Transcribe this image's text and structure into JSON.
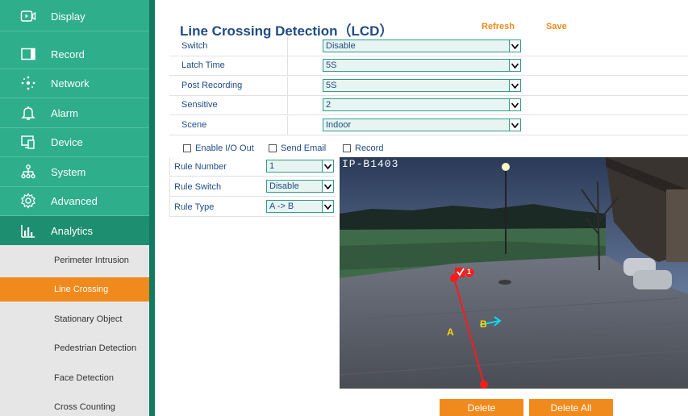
{
  "sidebar": {
    "items": [
      {
        "label": "Display",
        "icon": "display-icon"
      },
      {
        "label": "Record",
        "icon": "record-icon"
      },
      {
        "label": "Network",
        "icon": "network-icon"
      },
      {
        "label": "Alarm",
        "icon": "alarm-bell-icon"
      },
      {
        "label": "Device",
        "icon": "device-icon"
      },
      {
        "label": "System",
        "icon": "system-icon"
      },
      {
        "label": "Advanced",
        "icon": "advanced-gear-icon"
      },
      {
        "label": "Analytics",
        "icon": "analytics-chart-icon"
      }
    ],
    "active": "Analytics",
    "submenu": [
      {
        "label": "Perimeter Intrusion"
      },
      {
        "label": "Line Crossing"
      },
      {
        "label": "Stationary Object"
      },
      {
        "label": "Pedestrian Detection"
      },
      {
        "label": "Face Detection"
      },
      {
        "label": "Cross Counting"
      }
    ],
    "active_submenu": "Line Crossing"
  },
  "header": {
    "title": "Line Crossing Detection（LCD）",
    "refresh_label": "Refresh",
    "save_label": "Save"
  },
  "settings": {
    "switch": {
      "label": "Switch",
      "value": "Disable"
    },
    "latch_time": {
      "label": "Latch Time",
      "value": "5S"
    },
    "post_recording": {
      "label": "Post Recording",
      "value": "5S"
    },
    "sensitive": {
      "label": "Sensitive",
      "value": "2"
    },
    "scene": {
      "label": "Scene",
      "value": "Indoor"
    }
  },
  "checkboxes": {
    "enable_io_out": {
      "label": "Enable I/O Out",
      "checked": false
    },
    "send_email": {
      "label": "Send Email",
      "checked": false
    },
    "record": {
      "label": "Record",
      "checked": false
    }
  },
  "rules": {
    "rule_number": {
      "label": "Rule Number",
      "value": "1"
    },
    "rule_switch": {
      "label": "Rule Switch",
      "value": "Disable"
    },
    "rule_type": {
      "label": "Rule Type",
      "value": "A -> B"
    }
  },
  "video": {
    "osd": "IP-B1403",
    "marker_a": "A",
    "marker_b": "B",
    "rule_badge": "1"
  },
  "buttons": {
    "delete_label": "Delete",
    "delete_all_label": "Delete All"
  },
  "colors": {
    "sidebar": "#2eae8b",
    "accent": "#f08a1c",
    "title": "#1f4b84",
    "line": "#ff1a1a",
    "arrow": "#00e5ff",
    "marker": "#ffd400"
  }
}
